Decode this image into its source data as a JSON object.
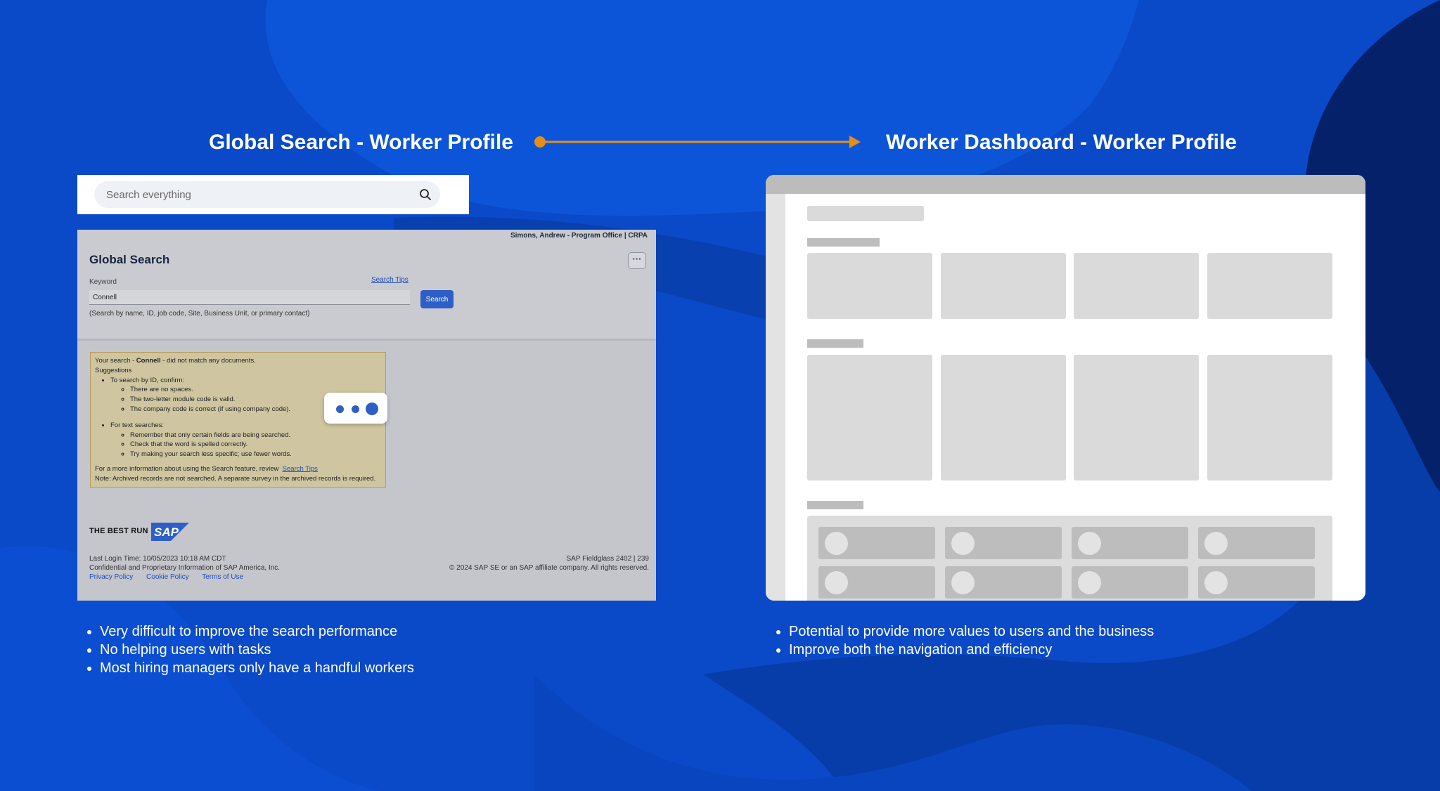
{
  "slide": {
    "left_heading": "Global Search - Worker Profile",
    "right_heading": "Worker Dashboard - Worker Profile",
    "left_bullets": [
      "Very difficult to improve the search performance",
      "No helping users with tasks",
      "Most hiring managers only have a handful workers"
    ],
    "right_bullets": [
      "Potential to provide more values to users and the business",
      "Improve both the navigation and efficiency"
    ],
    "colors": {
      "background": "#0a49c8",
      "accent_arrow": "#e58e1a",
      "primary_button": "#2e5fc6"
    }
  },
  "search_bar": {
    "placeholder": "Search everything",
    "icon": "search-icon"
  },
  "global_search": {
    "user_info": "Simons, Andrew - Program Office | CRPA",
    "title": "Global Search",
    "more_label": "···",
    "keyword_label": "Keyword",
    "search_tips_label": "Search Tips",
    "keyword_value": "Connell",
    "search_button": "Search",
    "hint": "(Search by name, ID, job code, Site, Business Unit, or primary contact)",
    "no_results": {
      "prefix": "Your search - ",
      "term": "Connell",
      "suffix": " - did not match any documents.",
      "suggestions_label": "Suggestions",
      "id_heading": "To search by ID, confirm:",
      "id_items": [
        "There are no spaces.",
        "The two-letter module code is valid.",
        "The company code is correct (if using company code)."
      ],
      "text_heading": "For text searches:",
      "text_items": [
        "Remember that only certain fields are being searched.",
        "Check that the word is spelled correctly.",
        "Try making your search less specific; use fewer words."
      ],
      "more_info": "For a more information about using the Search feature, review",
      "more_info_link": "Search Tips",
      "note": "Note: Archived records are not searched. A separate survey in the archived records is required."
    },
    "footer": {
      "brand": "THE BEST RUN",
      "logo_text": "SAP",
      "last_login": "Last Login Time: 10/05/2023 10:18 AM CDT",
      "confidential": "Confidential and Proprietary Information of SAP America, Inc.",
      "links": [
        "Privacy Policy",
        "Cookie Policy",
        "Terms of Use"
      ],
      "version": "SAP Fieldglass 2402 | 239",
      "copyright": "© 2024 SAP SE or an SAP affiliate company. All rights reserved."
    }
  }
}
